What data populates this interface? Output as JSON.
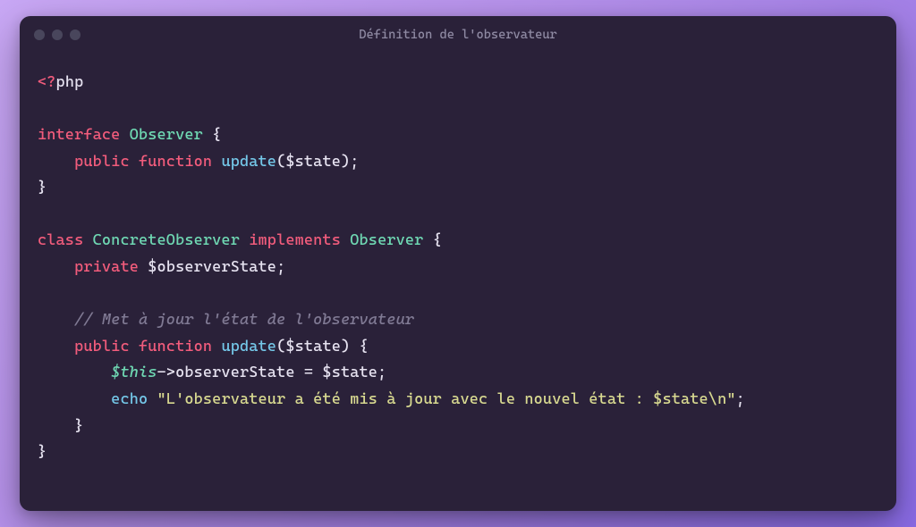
{
  "window": {
    "title": "Définition de l'observateur"
  },
  "code": {
    "open_tag_prefix": "<?",
    "open_tag_php": "php",
    "kw_interface": "interface",
    "type_observer": "Observer",
    "brace_open": "{",
    "brace_close": "}",
    "kw_public": "public",
    "kw_function": "function",
    "fn_update": "update",
    "paren_open": "(",
    "paren_close": ")",
    "var_state": "$state",
    "semi": ";",
    "kw_class": "class",
    "type_concrete": "ConcreteObserver",
    "kw_implements": "implements",
    "kw_private": "private",
    "var_observerState": "$observerState",
    "comment_update": "// Met à jour l'état de l'observateur",
    "this_kw": "$this",
    "arrow": "->",
    "prop_observerState": "observerState",
    "assign": " = ",
    "echo_kw": "echo",
    "string_msg": "\"L'observateur a été mis à jour avec le nouvel état : $state\\n\""
  }
}
